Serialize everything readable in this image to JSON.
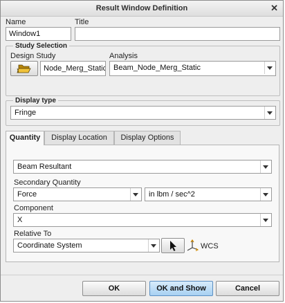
{
  "dialog": {
    "title": "Result Window Definition",
    "close_glyph": "✕"
  },
  "fields": {
    "name_label": "Name",
    "name_value": "Window1",
    "title_label": "Title",
    "title_value": ""
  },
  "study_selection": {
    "legend": "Study Selection",
    "design_study_label": "Design Study",
    "design_study_value": "Node_Merg_Static",
    "analysis_label": "Analysis",
    "analysis_value": "Beam_Node_Merg_Static"
  },
  "display_type": {
    "legend": "Display type",
    "value": "Fringe"
  },
  "tabs": [
    {
      "label": "Quantity",
      "active": true
    },
    {
      "label": "Display Location",
      "active": false
    },
    {
      "label": "Display Options",
      "active": false
    }
  ],
  "quantity": {
    "quantity_value": "Beam Resultant",
    "secondary_label": "Secondary Quantity",
    "secondary_value": "Force",
    "units_value": "in lbm / sec^2",
    "component_label": "Component",
    "component_value": "X",
    "relative_label": "Relative To",
    "relative_value": "Coordinate System",
    "csys_name": "WCS"
  },
  "buttons": {
    "ok": "OK",
    "ok_show": "OK and Show",
    "cancel": "Cancel"
  },
  "icons": {
    "open": "folder-open-icon",
    "select": "cursor-arrow-icon",
    "csys": "coordinate-system-icon"
  }
}
